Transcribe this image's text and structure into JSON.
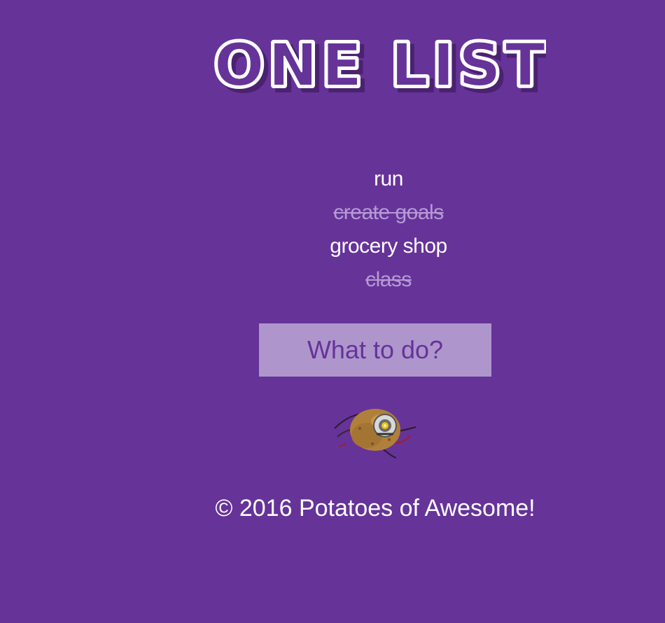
{
  "app": {
    "title": "ONE LIST"
  },
  "todos": [
    {
      "label": "run",
      "done": false
    },
    {
      "label": "create goals",
      "done": true
    },
    {
      "label": "grocery shop",
      "done": false
    },
    {
      "label": "class",
      "done": true
    }
  ],
  "input": {
    "placeholder": "What to do?",
    "value": ""
  },
  "mascot": {
    "icon": "potato-glados-icon"
  },
  "footer": {
    "text": "© 2016 Potatoes of Awesome!"
  },
  "colors": {
    "background": "#663399",
    "input_background": "#ae96cd",
    "done_text": "#b59ad6",
    "text": "#ffffff"
  }
}
